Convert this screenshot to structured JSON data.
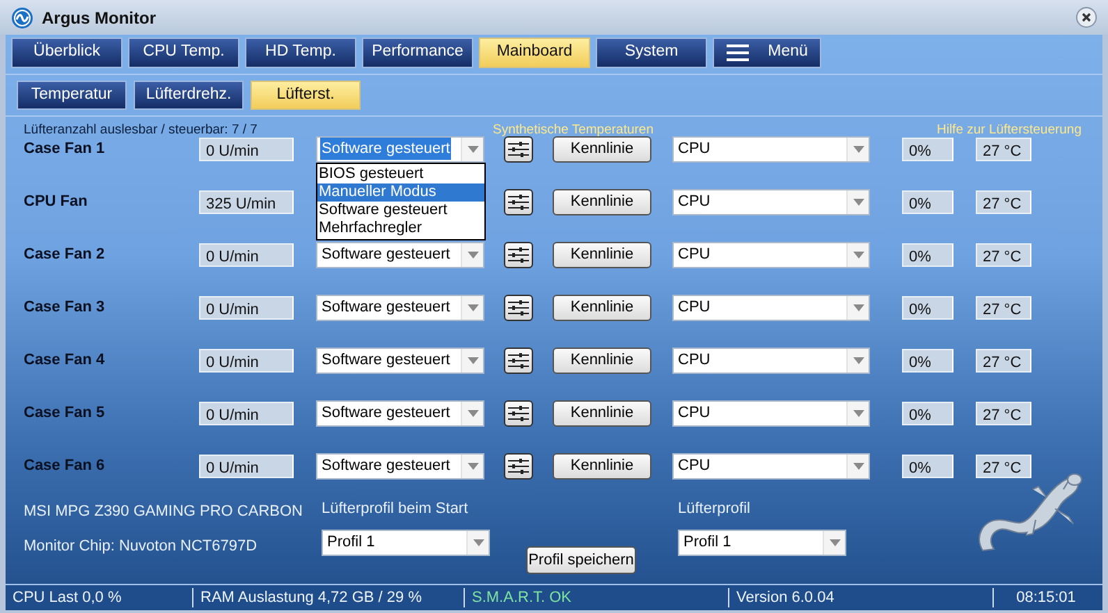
{
  "window": {
    "title": "Argus Monitor"
  },
  "tabs": [
    {
      "label": "Überblick",
      "kind": "tab",
      "selected": false
    },
    {
      "label": "CPU Temp.",
      "kind": "tab",
      "selected": false
    },
    {
      "label": "HD Temp.",
      "kind": "tab",
      "selected": false
    },
    {
      "label": "Performance",
      "kind": "tab",
      "selected": false
    },
    {
      "label": "Mainboard",
      "kind": "tab",
      "selected": true
    },
    {
      "label": "System",
      "kind": "tab",
      "selected": false
    },
    {
      "label": "Menü",
      "kind": "menu",
      "selected": false
    }
  ],
  "subtabs": [
    {
      "label": "Temperatur",
      "selected": false
    },
    {
      "label": "Lüfterdrehz.",
      "selected": false
    },
    {
      "label": "Lüfterst.",
      "selected": true
    }
  ],
  "fan_count": "Lüfteranzahl auslesbar / steuerbar: 7 / 7",
  "synthetic_link": "Synthetische Temperaturen",
  "help_link": "Hilfe zur Lüftersteuerung",
  "fans": [
    {
      "name": "Case Fan 1",
      "rpm": "0 U/min",
      "mode": "Software gesteuert",
      "mode_focused": true,
      "curve_button": "Kennlinie",
      "source": "CPU",
      "percent": "0%",
      "temperature": "27 °C"
    },
    {
      "name": "CPU Fan",
      "rpm": "325 U/min",
      "curve_button": "Kennlinie",
      "source": "CPU",
      "percent": "0%",
      "temperature": "27 °C"
    },
    {
      "name": "Case Fan 2",
      "rpm": "0 U/min",
      "mode": "Software gesteuert",
      "mode_focused": false,
      "curve_button": "Kennlinie",
      "source": "CPU",
      "percent": "0%",
      "temperature": "27 °C"
    },
    {
      "name": "Case Fan 3",
      "rpm": "0 U/min",
      "mode": "Software gesteuert",
      "mode_focused": false,
      "curve_button": "Kennlinie",
      "source": "CPU",
      "percent": "0%",
      "temperature": "27 °C"
    },
    {
      "name": "Case Fan 4",
      "rpm": "0 U/min",
      "mode": "Software gesteuert",
      "mode_focused": false,
      "curve_button": "Kennlinie",
      "source": "CPU",
      "percent": "0%",
      "temperature": "27 °C"
    },
    {
      "name": "Case Fan 5",
      "rpm": "0 U/min",
      "mode": "Software gesteuert",
      "mode_focused": false,
      "curve_button": "Kennlinie",
      "source": "CPU",
      "percent": "0%",
      "temperature": "27 °C"
    },
    {
      "name": "Case Fan 6",
      "rpm": "0 U/min",
      "mode": "Software gesteuert",
      "mode_focused": false,
      "curve_button": "Kennlinie",
      "source": "CPU",
      "percent": "0%",
      "temperature": "27 °C"
    }
  ],
  "mode_dropdown": {
    "options": [
      {
        "label": "BIOS gesteuert",
        "selected": false
      },
      {
        "label": "Manueller Modus",
        "selected": true
      },
      {
        "label": "Software gesteuert",
        "selected": false
      },
      {
        "label": "Mehrfachregler",
        "selected": false
      }
    ]
  },
  "footer": {
    "board": "MSI MPG Z390 GAMING PRO CARBON",
    "chip": "Monitor Chip: Nuvoton NCT6797D",
    "start_profile_label": "Lüfterprofil beim Start",
    "start_profile": "Profil 1",
    "save_button": "Profil speichern",
    "profile_label": "Lüfterprofil",
    "profile": "Profil 1"
  },
  "status_bar": [
    {
      "text": "CPU Last 0,0 %",
      "kind": "plain"
    },
    {
      "text": "RAM Auslastung 4,72 GB / 29 %",
      "kind": "plain"
    },
    {
      "text": "S.M.A.R.T. OK",
      "kind": "ok"
    },
    {
      "text": "Version 6.0.04",
      "kind": "plain"
    },
    {
      "text": "08:15:01",
      "kind": "plain"
    }
  ]
}
